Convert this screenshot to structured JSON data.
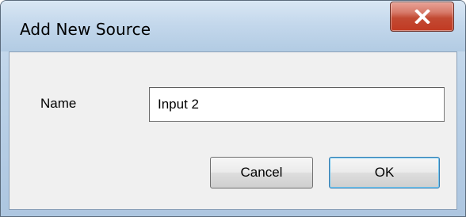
{
  "dialog": {
    "title": "Add New Source",
    "close_icon": "close-x-icon"
  },
  "form": {
    "name_label": "Name",
    "name_value": "Input 2"
  },
  "buttons": {
    "cancel_label": "Cancel",
    "ok_label": "OK"
  },
  "colors": {
    "close_button": "#c13a22",
    "titlebar": "#c4d8ec",
    "client_bg": "#f0f0f0",
    "ok_focus": "#3c7fb1"
  }
}
